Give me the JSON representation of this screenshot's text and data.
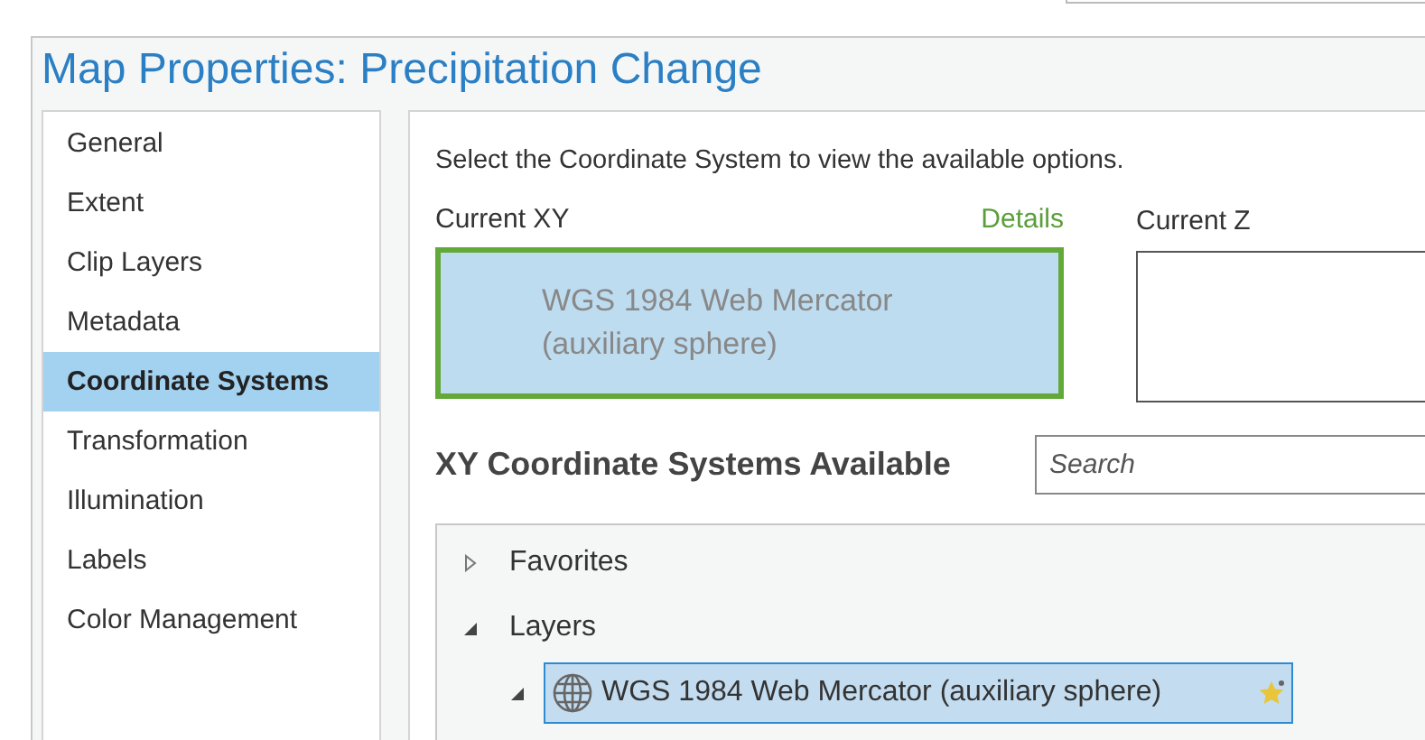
{
  "window": {
    "title": "Map Properties: Precipitation Change"
  },
  "sidebar": {
    "items": [
      {
        "label": "General",
        "selected": false
      },
      {
        "label": "Extent",
        "selected": false
      },
      {
        "label": "Clip Layers",
        "selected": false
      },
      {
        "label": "Metadata",
        "selected": false
      },
      {
        "label": "Coordinate Systems",
        "selected": true
      },
      {
        "label": "Transformation",
        "selected": false
      },
      {
        "label": "Illumination",
        "selected": false
      },
      {
        "label": "Labels",
        "selected": false
      },
      {
        "label": "Color Management",
        "selected": false
      }
    ]
  },
  "panel": {
    "instruction": "Select the Coordinate System to view the available options.",
    "current_xy": {
      "label": "Current XY",
      "details_link": "Details",
      "value": "WGS 1984 Web Mercator (auxiliary sphere)"
    },
    "current_z": {
      "label": "Current Z"
    },
    "available": {
      "heading": "XY Coordinate Systems Available",
      "search": {
        "placeholder": "Search"
      },
      "tree": [
        {
          "label": "Favorites",
          "expanded": false,
          "kind": "folder"
        },
        {
          "label": "Layers",
          "expanded": true,
          "kind": "folder",
          "children": [
            {
              "label": "WGS 1984 Web Mercator (auxiliary sphere)",
              "expanded": true,
              "selected": true,
              "kind": "system",
              "favorite": true
            }
          ]
        }
      ]
    }
  }
}
